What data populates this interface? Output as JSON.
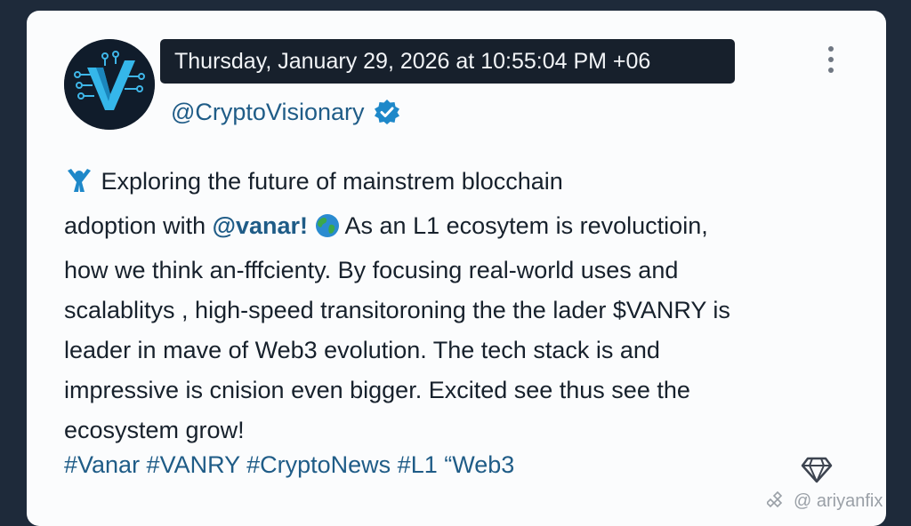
{
  "post": {
    "timestamp": "Thursday, January 29, 2026 at 10:55:04 PM +06",
    "handle": "@CryptoVisionary",
    "body": {
      "line1": "Exploring the future of mainstrem blocchain",
      "line2_before": "adoption with ",
      "line2_mention": "@vanar!",
      "line2_after": " As an L1 ecosytem is revoluctioin,",
      "line3": "how we think an-fffcienty. By focusing real-world uses  and",
      "line4": "scalablitys , high-speed transitoroning the the lader  $VANRY is",
      "line5": "leader in mave of Web3 evolution. The tech stack is  and",
      "line6": "impressive is cnision even bigger. Excited see thus see the",
      "line7": "ecosystem grow!"
    },
    "hashtags": "#Vanar #VANRY #CryptoNews #L1 “Web3"
  },
  "watermark": {
    "text": "@ ariyanfix"
  },
  "icons": {
    "avatar": "vanar-logo-icon",
    "verified": "verified-badge-icon",
    "more": "more-vertical-icon",
    "leading_emoji": "person-arms-up-icon",
    "globe": "globe-icon",
    "gem": "diamond-icon"
  },
  "colors": {
    "accent": "#1f5c87",
    "verified": "#1e88c9",
    "card": "#fbfcfd",
    "timestamp_bg": "#17202c"
  }
}
